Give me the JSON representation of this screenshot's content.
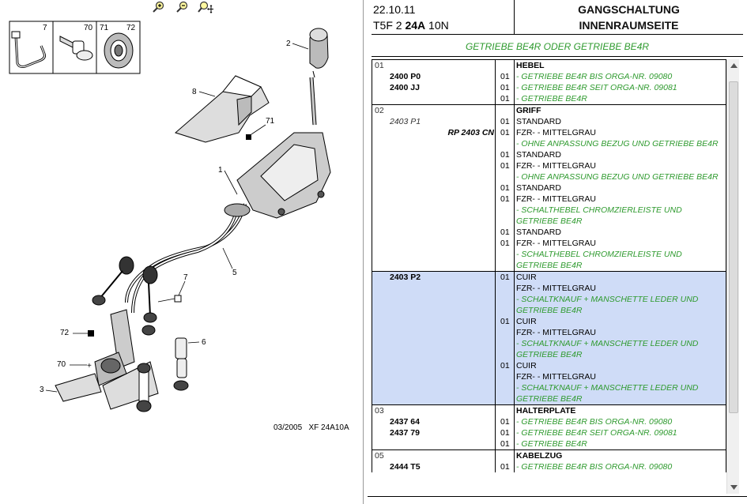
{
  "zoom_toolbar": {
    "icons": [
      "zoom-in-icon",
      "zoom-out-icon",
      "zoom-pan-icon"
    ]
  },
  "diagram": {
    "callouts": [
      "7",
      "70",
      "71",
      "72",
      "2",
      "8",
      "71",
      "1",
      "5",
      "7",
      "72",
      "6",
      "70",
      "3"
    ],
    "caption": "03/2005   XF 24A10A"
  },
  "header": {
    "date": "22.10.11",
    "code_prefix": "T5F 2 ",
    "code_bold": "24A",
    "code_suffix": " 10N",
    "title_line1": "GANGSCHALTUNG",
    "title_line2": "INNENRAUMSEITE"
  },
  "subtitle": "GETRIEBE BE4R ODER GETRIEBE BE4R",
  "groups": [
    {
      "num": "01",
      "title": "HEBEL",
      "selected": false,
      "rows": [
        {
          "num": "01",
          "ref": "",
          "rp": "",
          "qty": "",
          "desc": "HEBEL",
          "style": "b"
        },
        {
          "num": "",
          "ref": "2400 P0",
          "rp": "",
          "qty": "01",
          "desc": "- GETRIEBE BE4R BIS ORGA-NR. 09080",
          "style": "g"
        },
        {
          "num": "",
          "ref": "2400 JJ",
          "rp": "",
          "qty": "01",
          "desc": "- GETRIEBE BE4R SEIT ORGA-NR. 09081",
          "style": "g"
        },
        {
          "num": "",
          "ref": "",
          "rp": "",
          "qty": "01",
          "desc": "- GETRIEBE BE4R",
          "style": "g"
        }
      ]
    },
    {
      "selected": false,
      "rows": [
        {
          "num": "02",
          "ref": "",
          "rp": "",
          "qty": "",
          "desc": "GRIFF",
          "style": "b"
        },
        {
          "num": "",
          "ref": "2403 P1",
          "refit": true,
          "rp": "",
          "qty": "01",
          "desc": "STANDARD",
          "style": ""
        },
        {
          "num": "",
          "ref": "",
          "rp": "RP 2403 CN",
          "qty": "01",
          "desc": "FZR- - MITTELGRAU",
          "style": ""
        },
        {
          "num": "",
          "ref": "",
          "rp": "",
          "qty": "",
          "desc": "- OHNE ANPASSUNG BEZUG UND GETRIEBE BE4R",
          "style": "g"
        },
        {
          "num": "",
          "ref": "",
          "rp": "",
          "qty": "01",
          "desc": "STANDARD",
          "style": ""
        },
        {
          "num": "",
          "ref": "",
          "rp": "",
          "qty": "01",
          "desc": "FZR- - MITTELGRAU",
          "style": ""
        },
        {
          "num": "",
          "ref": "",
          "rp": "",
          "qty": "",
          "desc": "- OHNE ANPASSUNG BEZUG UND GETRIEBE BE4R",
          "style": "g"
        },
        {
          "num": "",
          "ref": "",
          "rp": "",
          "qty": "01",
          "desc": "STANDARD",
          "style": ""
        },
        {
          "num": "",
          "ref": "",
          "rp": "",
          "qty": "01",
          "desc": "FZR- - MITTELGRAU",
          "style": ""
        },
        {
          "num": "",
          "ref": "",
          "rp": "",
          "qty": "",
          "desc": "- SCHALTHEBEL CHROMZIERLEISTE UND",
          "style": "g"
        },
        {
          "num": "",
          "ref": "",
          "rp": "",
          "qty": "",
          "desc": "GETRIEBE BE4R",
          "style": "g"
        },
        {
          "num": "",
          "ref": "",
          "rp": "",
          "qty": "01",
          "desc": "STANDARD",
          "style": ""
        },
        {
          "num": "",
          "ref": "",
          "rp": "",
          "qty": "01",
          "desc": "FZR- - MITTELGRAU",
          "style": ""
        },
        {
          "num": "",
          "ref": "",
          "rp": "",
          "qty": "",
          "desc": "- SCHALTHEBEL CHROMZIERLEISTE UND",
          "style": "g"
        },
        {
          "num": "",
          "ref": "",
          "rp": "",
          "qty": "",
          "desc": "GETRIEBE BE4R",
          "style": "g"
        }
      ]
    },
    {
      "selected": true,
      "rows": [
        {
          "num": "",
          "ref": "2403 P2",
          "rp": "",
          "qty": "01",
          "desc": "CUIR",
          "style": ""
        },
        {
          "num": "",
          "ref": "",
          "rp": "",
          "qty": "",
          "desc": "FZR- - MITTELGRAU",
          "style": ""
        },
        {
          "num": "",
          "ref": "",
          "rp": "",
          "qty": "",
          "desc": "- SCHALTKNAUF + MANSCHETTE LEDER UND",
          "style": "g"
        },
        {
          "num": "",
          "ref": "",
          "rp": "",
          "qty": "",
          "desc": "GETRIEBE BE4R",
          "style": "g"
        },
        {
          "num": "",
          "ref": "",
          "rp": "",
          "qty": "01",
          "desc": "CUIR",
          "style": ""
        },
        {
          "num": "",
          "ref": "",
          "rp": "",
          "qty": "",
          "desc": "FZR- - MITTELGRAU",
          "style": ""
        },
        {
          "num": "",
          "ref": "",
          "rp": "",
          "qty": "",
          "desc": "- SCHALTKNAUF + MANSCHETTE LEDER UND",
          "style": "g"
        },
        {
          "num": "",
          "ref": "",
          "rp": "",
          "qty": "",
          "desc": "GETRIEBE BE4R",
          "style": "g"
        },
        {
          "num": "",
          "ref": "",
          "rp": "",
          "qty": "01",
          "desc": "CUIR",
          "style": ""
        },
        {
          "num": "",
          "ref": "",
          "rp": "",
          "qty": "",
          "desc": "FZR- - MITTELGRAU",
          "style": ""
        },
        {
          "num": "",
          "ref": "",
          "rp": "",
          "qty": "",
          "desc": "- SCHALTKNAUF + MANSCHETTE LEDER UND",
          "style": "g"
        },
        {
          "num": "",
          "ref": "",
          "rp": "",
          "qty": "",
          "desc": "GETRIEBE BE4R",
          "style": "g"
        }
      ]
    },
    {
      "selected": false,
      "rows": [
        {
          "num": "03",
          "ref": "",
          "rp": "",
          "qty": "",
          "desc": "HALTERPLATE",
          "style": "b"
        },
        {
          "num": "",
          "ref": "2437 64",
          "rp": "",
          "qty": "01",
          "desc": "- GETRIEBE BE4R BIS ORGA-NR. 09080",
          "style": "g"
        },
        {
          "num": "",
          "ref": "2437 79",
          "rp": "",
          "qty": "01",
          "desc": "- GETRIEBE BE4R SEIT ORGA-NR. 09081",
          "style": "g"
        },
        {
          "num": "",
          "ref": "",
          "rp": "",
          "qty": "01",
          "desc": "- GETRIEBE BE4R",
          "style": "g"
        }
      ]
    },
    {
      "selected": false,
      "rows": [
        {
          "num": "05",
          "ref": "",
          "rp": "",
          "qty": "",
          "desc": "KABELZUG",
          "style": "b"
        },
        {
          "num": "",
          "ref": "2444 T5",
          "rp": "",
          "qty": "01",
          "desc": "- GETRIEBE BE4R BIS ORGA-NR. 09080",
          "style": "g"
        }
      ]
    }
  ]
}
